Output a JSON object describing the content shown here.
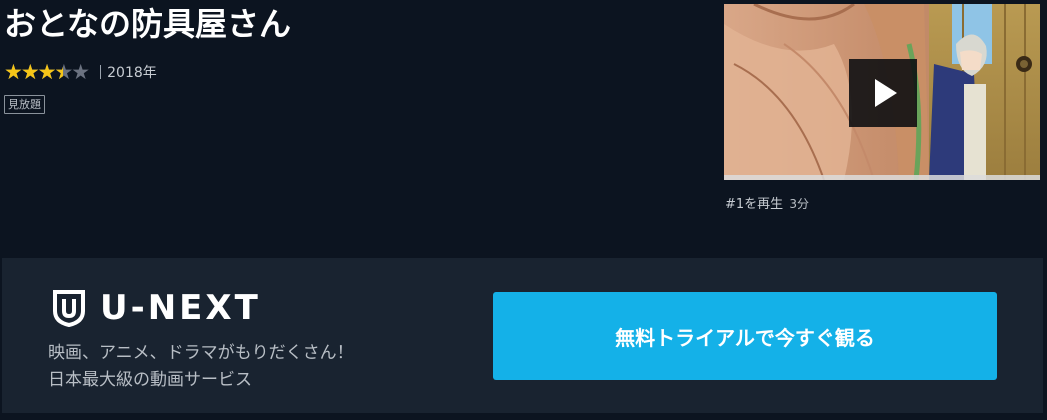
{
  "title": "おとなの防具屋さん",
  "rating": {
    "value": 3.5,
    "max": 5,
    "star_color": "#f5c518",
    "empty_star_color": "#6b7280"
  },
  "year": "2018年",
  "badge": "見放題",
  "episode": {
    "label": "#1を再生",
    "duration": "3分",
    "thumbnail_icon": "play-icon"
  },
  "banner": {
    "brand": "U-NEXT",
    "tagline_line1": "映画、アニメ、ドラマがもりだくさん！",
    "tagline_line2": "日本最大級の動画サービス",
    "cta_label": "無料トライアルで今すぐ観る",
    "cta_color": "#14b1e8"
  },
  "colors": {
    "background": "#0c1420",
    "banner_background": "#192330"
  }
}
